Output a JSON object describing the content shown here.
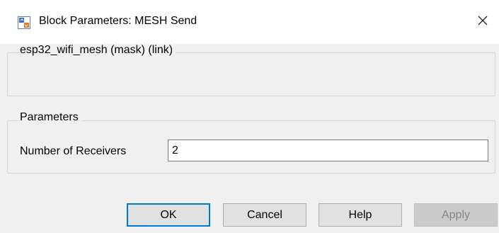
{
  "window": {
    "title": "Block Parameters: MESH Send",
    "app_icon": "simulink-block-icon",
    "close_icon": "close-icon"
  },
  "description_group": {
    "legend": "esp32_wifi_mesh (mask) (link)"
  },
  "parameters_group": {
    "legend": "Parameters",
    "fields": [
      {
        "label": "Number of Receivers",
        "value": "2"
      }
    ]
  },
  "buttons": {
    "ok": "OK",
    "cancel": "Cancel",
    "help": "Help",
    "apply": "Apply"
  },
  "colors": {
    "focus_border": "#0078d7",
    "button_bg": "#e1e1e1",
    "disabled_bg": "#cccccc",
    "disabled_text": "#838383",
    "dialog_bg": "#f0f0f0"
  }
}
